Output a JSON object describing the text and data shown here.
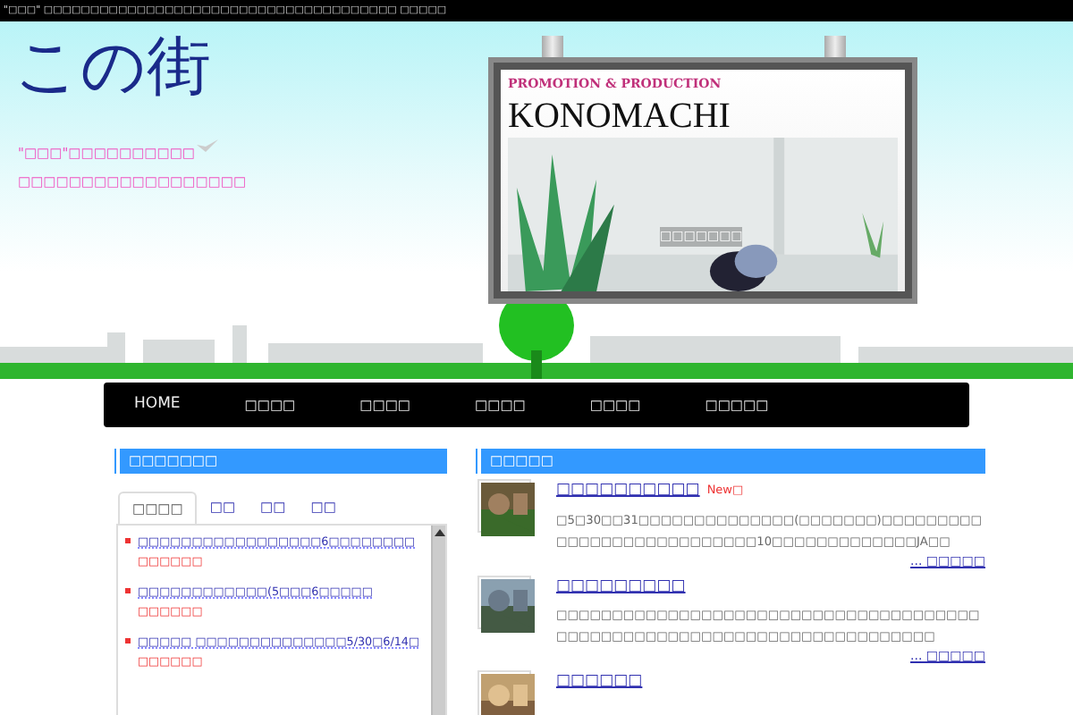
{
  "top_bar": {
    "text": "\"□□□\" □□□□□□□□□□□□□□□□□□□□□□□□□□□□□□□□□□□□□□ □□□□□"
  },
  "header": {
    "logo": "この街",
    "tagline": [
      "\"□□□\"□□□□□□□□□□",
      "□□□□□□□□□□□□□□□□□□"
    ]
  },
  "billboard": {
    "subtitle": "PROMOTION & PRODUCTION",
    "title": "KONOMACHI",
    "caption": "□□□□□□□"
  },
  "nav": [
    {
      "label": "HOME"
    },
    {
      "label": "□□□□"
    },
    {
      "label": "□□□□"
    },
    {
      "label": "□□□□"
    },
    {
      "label": "□□□□"
    },
    {
      "label": "□□□□□"
    }
  ],
  "sidebar": {
    "title": "□□□□□□□",
    "tabs": [
      {
        "label": "□□□□",
        "selected": true
      },
      {
        "label": "□□",
        "selected": false
      },
      {
        "label": "□□",
        "selected": false
      },
      {
        "label": "□□",
        "selected": false
      }
    ],
    "items": [
      {
        "title": "□□□□□□□□□□□□□□□□□6□□□□□□□□",
        "date": "□□□□□□"
      },
      {
        "title": "□□□□□□□□□□□□(5□□□6□□□□□",
        "date": "□□□□□□"
      },
      {
        "title": "□□□□□ □□□□□□□□□□□□□□5/30□6/14□",
        "date": "□□□□□□"
      }
    ]
  },
  "news": {
    "title": "□□□□□",
    "posts": [
      {
        "title": "□□□□□□□□□□",
        "badge": "New□",
        "excerpt": "□5□30□□31□□□□□□□□□□□□□□(□□□□□□□)□□□□□□□□□□□□□□□□□□□□□□□□□□□10□□□□□□□□□□□□□JA□□",
        "more": "... □□□□□"
      },
      {
        "title": "□□□□□□□□□",
        "excerpt": "□□□□□□□□□□□□□□□□□□□□□□□□□□□□□□□□□□□□□□□□□□□□□□□□□□□□□□□□□□□□□□□□□□□□□□□□",
        "more": "... □□□□□"
      },
      {
        "title": "□□□□□□"
      }
    ]
  }
}
